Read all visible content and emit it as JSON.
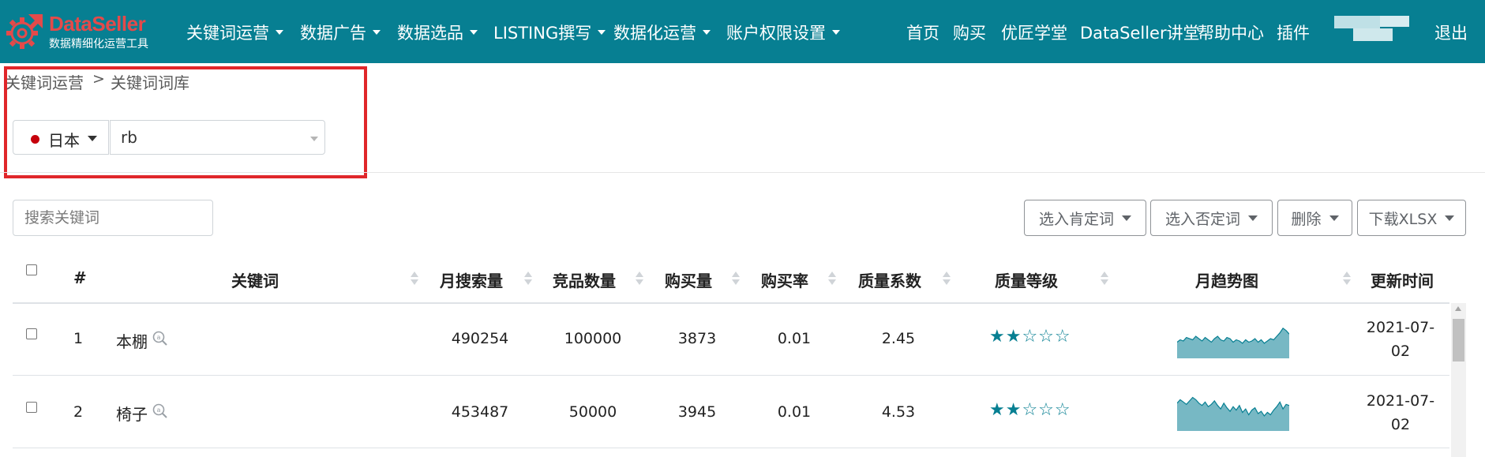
{
  "brand": {
    "name": "DataSeller",
    "tagline": "数据精细化运营工具",
    "color": "#e44a4a"
  },
  "theme": {
    "nav_bg": "#077f92",
    "accent": "#077f92",
    "highlight_border": "#e0262a",
    "country_dot": "#c6000b"
  },
  "nav": {
    "menus": [
      {
        "label": "关键词运营",
        "dropdown": true
      },
      {
        "label": "数据广告",
        "dropdown": true
      },
      {
        "label": "数据选品",
        "dropdown": true
      },
      {
        "label": "LISTING撰写",
        "dropdown": true
      },
      {
        "label": "数据化运营",
        "dropdown": true
      },
      {
        "label": "账户权限设置",
        "dropdown": true
      }
    ],
    "links": [
      "首页",
      "购买",
      "优匠学堂",
      "DataSeller讲堂",
      "帮助中心",
      "插件"
    ],
    "logout": "退出"
  },
  "breadcrumb": {
    "parent": "关键词运营",
    "separator": ">",
    "current": "关键词词库"
  },
  "selectors": {
    "country": "日本",
    "shop": "rb"
  },
  "toolbar": {
    "search_placeholder": "搜索关键词",
    "buttons": [
      "选入肯定词",
      "选入否定词",
      "删除",
      "下载XLSX"
    ]
  },
  "table": {
    "columns": [
      "#",
      "关键词",
      "月搜索量",
      "竞品数量",
      "购买量",
      "购买率",
      "质量系数",
      "质量等级",
      "月趋势图",
      "更新时间"
    ],
    "rows": [
      {
        "index": "1",
        "keyword": "本棚",
        "monthly_search": "490254",
        "competitors": "100000",
        "purchases": "3873",
        "purchase_rate": "0.01",
        "quality_coef": "2.45",
        "quality_stars": 2,
        "max_stars": 5,
        "updated": "2021-07-02",
        "trend": [
          14,
          16,
          15,
          18,
          17,
          16,
          19,
          17,
          15,
          18,
          16,
          14,
          17,
          19,
          16,
          15,
          18,
          17,
          14,
          16,
          15,
          13,
          16,
          14,
          15,
          17,
          14,
          16,
          13,
          15,
          17,
          16,
          19,
          22,
          26,
          24,
          21
        ]
      },
      {
        "index": "2",
        "keyword": "椅子",
        "monthly_search": "453487",
        "competitors": "50000",
        "purchases": "3945",
        "purchase_rate": "0.01",
        "quality_coef": "4.53",
        "quality_stars": 2,
        "max_stars": 5,
        "updated": "2021-07-02",
        "trend": [
          24,
          27,
          25,
          23,
          26,
          29,
          27,
          24,
          22,
          25,
          21,
          23,
          26,
          22,
          19,
          24,
          20,
          17,
          21,
          18,
          22,
          16,
          19,
          14,
          18,
          20,
          15,
          17,
          13,
          16,
          14,
          18,
          21,
          25,
          19,
          23,
          22
        ]
      }
    ]
  }
}
